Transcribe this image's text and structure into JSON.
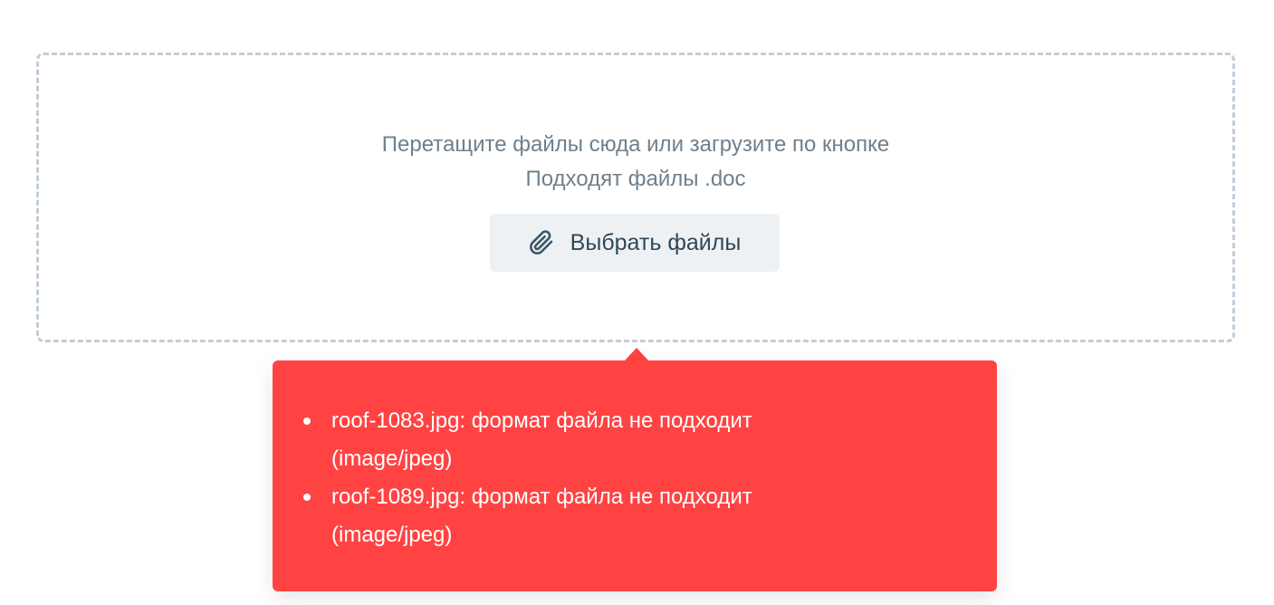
{
  "dropzone": {
    "instruction": "Перетащите файлы сюда или загрузите по кнопке",
    "accepted_formats": "Подходят файлы .doc",
    "select_button_label": "Выбрать файлы",
    "select_button_icon": "paperclip-icon"
  },
  "error_tooltip": {
    "color": "#ff4343",
    "errors": [
      "roof-1083.jpg: формат файла не подходит (image/jpeg)",
      "roof-1089.jpg: формат файла не подходит (image/jpeg)"
    ]
  }
}
